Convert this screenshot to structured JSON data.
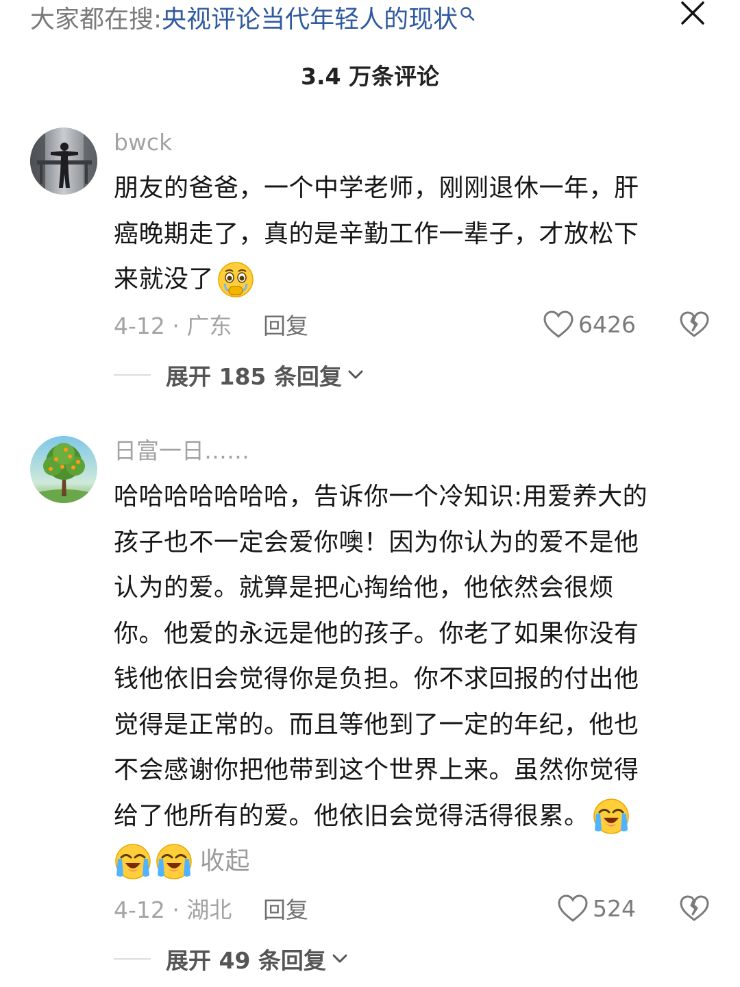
{
  "search_hint": {
    "prefix": "大家都在搜:",
    "topic": "央视评论当代年轻人的现状"
  },
  "header": {
    "comment_count": "3.4 万条评论"
  },
  "comments": [
    {
      "username": "bwck",
      "lines": [
        "朋友的爸爸，一个中学老师，刚刚退休一年，肝",
        "癌晚期走了，真的是辛勤工作一辈子，才放松下",
        "来就没了"
      ],
      "date_location": "4-12 · 广东",
      "reply_label": "回复",
      "likes": "6426",
      "expand_label": "展开 185 条回复",
      "emoji": "holding-back-tears-emoji"
    },
    {
      "username": "日富一日……",
      "lines": [
        "哈哈哈哈哈哈哈，告诉你一个冷知识:用爱养大的",
        "孩子也不一定会爱你噢！因为你认为的爱不是他",
        "认为的爱。就算是把心掏给他，他依然会很烦",
        "你。他爱的永远是他的孩子。你老了如果你没有",
        "钱他依旧会觉得你是负担。你不求回报的付出他",
        "觉得是正常的。而且等他到了一定的年纪，他也",
        "不会感谢你把他带到这个世界上来。虽然你觉得",
        "给了他所有的爱。他依旧会觉得活得很累。"
      ],
      "collapse_label": "收起",
      "date_location": "4-12 · 湖北",
      "reply_label": "回复",
      "likes": "524",
      "expand_label": "展开 49 条回复",
      "emoji": "loudly-crying-emoji"
    }
  ],
  "colors": {
    "topic_link": "#2f5a9e",
    "muted_text": "#a3a3a3",
    "body_text": "#161616"
  }
}
